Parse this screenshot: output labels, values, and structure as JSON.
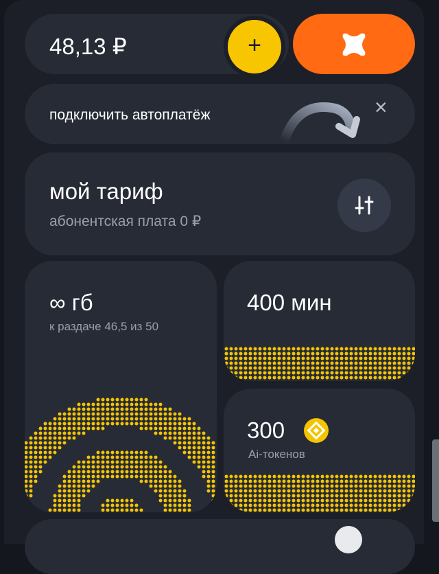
{
  "balance": {
    "amount": "48,13 ₽",
    "add_label": "+",
    "brand_icon": "brand-x-logo-icon",
    "colors": {
      "add": "#f7c600",
      "brand": "#ff6a13"
    }
  },
  "autopay": {
    "label": "подключить автоплатёж",
    "close_label": "×",
    "arrow_icon": "curved-arrow-icon"
  },
  "tariff": {
    "title": "мой тариф",
    "subtitle": "абонентская плата 0 ₽",
    "settings_icon": "sliders-icon"
  },
  "data_tile": {
    "title": "∞ гб",
    "subtitle": "к раздаче 46,5 из 50",
    "icon": "wifi-dots-icon"
  },
  "minutes_tile": {
    "title": "400 мин"
  },
  "tokens_tile": {
    "title": "300",
    "subtitle": "Ai-токенов",
    "badge_icon": "ai-token-diamond-icon",
    "badge_color": "#2f8df5"
  },
  "accent_color": "#f5c400"
}
